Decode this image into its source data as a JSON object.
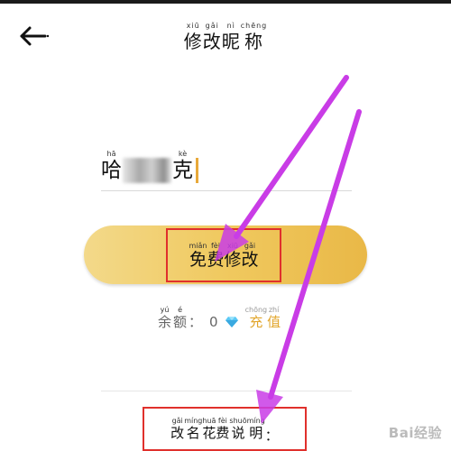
{
  "header": {
    "title": [
      {
        "py": "xiū",
        "hz": "修"
      },
      {
        "py": "gǎi",
        "hz": "改"
      },
      {
        "py": "nì",
        "hz": "昵"
      },
      {
        "py": "chēng",
        "hz": "称"
      }
    ]
  },
  "nickname": {
    "first": {
      "py": "hā",
      "hz": "哈"
    },
    "last": {
      "py": "kè",
      "hz": "克"
    }
  },
  "free_button": {
    "label": [
      {
        "py": "miǎn",
        "hz": "免"
      },
      {
        "py": "fèi",
        "hz": "费"
      },
      {
        "py": "xiū",
        "hz": "修"
      },
      {
        "py": "gǎi",
        "hz": "改"
      }
    ]
  },
  "balance": {
    "label": [
      {
        "py": "yú",
        "hz": "余"
      },
      {
        "py": "é",
        "hz": "额"
      }
    ],
    "colon": "：",
    "value": "0",
    "recharge": [
      {
        "py": "chōng",
        "hz": "充"
      },
      {
        "py": "zhí",
        "hz": "值"
      }
    ]
  },
  "explanation": {
    "label": [
      {
        "py": "gǎi",
        "hz": "改"
      },
      {
        "py": "míng",
        "hz": "名"
      },
      {
        "py": "huā",
        "hz": "花"
      },
      {
        "py": "fèi",
        "hz": "费"
      },
      {
        "py": "shuō",
        "hz": "说"
      },
      {
        "py": "míng",
        "hz": "明"
      }
    ],
    "colon": "："
  },
  "watermark": "Bai经验",
  "colors": {
    "accent_gold": "#f0c95f",
    "recharge_text": "#e2a62c",
    "highlight_box": "#e0302c",
    "arrow": "#c93ce6",
    "diamond": "#5ac8f5"
  }
}
